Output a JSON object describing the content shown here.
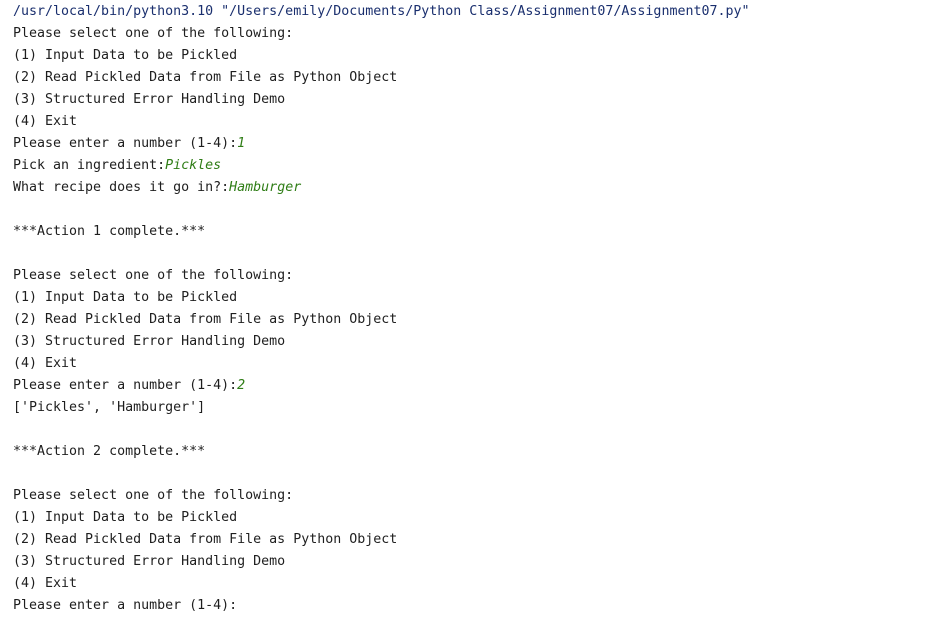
{
  "console": {
    "command_line": "/usr/local/bin/python3.10 \"/Users/emily/Documents/Python Class/Assignment07/Assignment07.py\"",
    "menu_1": {
      "header": "Please select one of the following:",
      "option_1": "(1) Input Data to be Pickled",
      "option_2": "(2) Read Pickled Data from File as Python Object",
      "option_3": "(3) Structured Error Handling Demo",
      "option_4": "(4) Exit",
      "prompt": "Please enter a number (1-4):",
      "input": "1"
    },
    "ingredient_prompt": "Pick an ingredient:",
    "ingredient_input": "Pickles",
    "recipe_prompt": "What recipe does it go in?:",
    "recipe_input": "Hamburger",
    "action_1_complete": "***Action 1 complete.***",
    "menu_2": {
      "header": "Please select one of the following:",
      "option_1": "(1) Input Data to be Pickled",
      "option_2": "(2) Read Pickled Data from File as Python Object",
      "option_3": "(3) Structured Error Handling Demo",
      "option_4": "(4) Exit",
      "prompt": "Please enter a number (1-4):",
      "input": "2"
    },
    "unpickled_output": "['Pickles', 'Hamburger']",
    "action_2_complete": "***Action 2 complete.***",
    "menu_3": {
      "header": "Please select one of the following:",
      "option_1": "(1) Input Data to be Pickled",
      "option_2": "(2) Read Pickled Data from File as Python Object",
      "option_3": "(3) Structured Error Handling Demo",
      "option_4": "(4) Exit",
      "prompt": "Please enter a number (1-4):"
    }
  }
}
